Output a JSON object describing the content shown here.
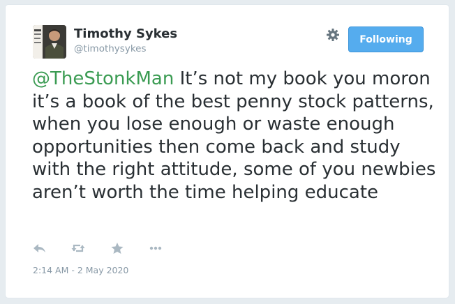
{
  "user": {
    "display_name": "Timothy Sykes",
    "handle": "@timothysykes"
  },
  "header": {
    "settings_icon": "gear-icon",
    "follow_label": "Following"
  },
  "tweet": {
    "mention": "@TheStonkMan",
    "body": " It’s not my book you moron it’s a book of the best penny stock patterns, when you lose enough or waste enough opportunities then come back and study with the right attitude, some of you newbies aren’t worth the time helping educate",
    "timestamp": "2:14 AM - 2 May 2020"
  },
  "actions": [
    "reply-icon",
    "retweet-icon",
    "favorite-icon",
    "more-icon"
  ],
  "colors": {
    "mention": "#3a9b52",
    "follow_button": "#55acee",
    "muted": "#8899a6",
    "text": "#292f33"
  }
}
